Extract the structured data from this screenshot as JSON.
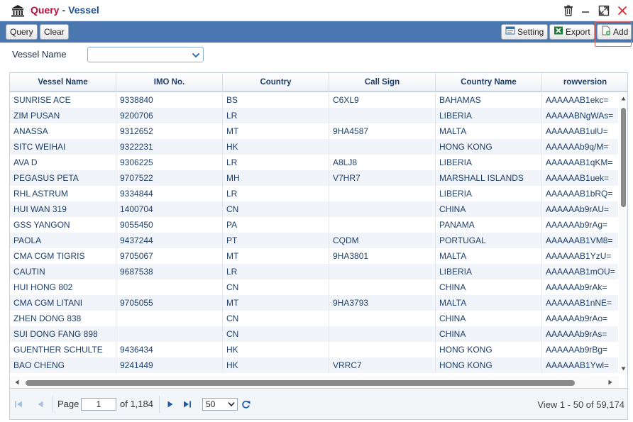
{
  "window": {
    "title_query": "Query",
    "title_separator": "-",
    "title_vessel": "Vessel",
    "icons": [
      "bank-icon",
      "trash-icon",
      "minimize-icon",
      "maximize-icon",
      "close-icon"
    ]
  },
  "toolbar": {
    "query_label": "Query",
    "clear_label": "Clear",
    "setting_label": "Setting",
    "export_label": "Export",
    "add_label": "Add"
  },
  "filter": {
    "vessel_name_label": "Vessel Name",
    "vessel_name_value": ""
  },
  "grid": {
    "columns": [
      "Vessel Name",
      "IMO No.",
      "Country",
      "Call Sign",
      "Country Name",
      "rowversion"
    ],
    "rows": [
      [
        "SUNRISE ACE",
        "9338840",
        "BS",
        "C6XL9",
        "BAHAMAS",
        "AAAAAAB1ekc="
      ],
      [
        "ZIM PUSAN",
        "9200706",
        "LR",
        "",
        "LIBERIA",
        "AAAAABNgWAs="
      ],
      [
        "ANASSA",
        "9312652",
        "MT",
        "9HA4587",
        "MALTA",
        "AAAAAAB1ulU="
      ],
      [
        "SITC WEIHAI",
        "9322231",
        "HK",
        "",
        "HONG KONG",
        "AAAAAAb9q/M="
      ],
      [
        "AVA D",
        "9306225",
        "LR",
        "A8LJ8",
        "LIBERIA",
        "AAAAAAB1qKM="
      ],
      [
        "PEGASUS PETA",
        "9707522",
        "MH",
        "V7HR7",
        "MARSHALL ISLANDS",
        "AAAAAAB1uek="
      ],
      [
        "RHL ASTRUM",
        "9334844",
        "LR",
        "",
        "LIBERIA",
        "AAAAAAB1bRQ="
      ],
      [
        "HUI WAN 319",
        "1400704",
        "CN",
        "",
        "CHINA",
        "AAAAAAb9rAU="
      ],
      [
        "GSS YANGON",
        "9055450",
        "PA",
        "",
        "PANAMA",
        "AAAAAAb9rAg="
      ],
      [
        "PAOLA",
        "9437244",
        "PT",
        "CQDM",
        "PORTUGAL",
        "AAAAAAB1VM8="
      ],
      [
        "CMA CGM TIGRIS",
        "9705067",
        "MT",
        "9HA3801",
        "MALTA",
        "AAAAAAB1YzU="
      ],
      [
        "CAUTIN",
        "9687538",
        "LR",
        "",
        "LIBERIA",
        "AAAAAAB1mOU="
      ],
      [
        "HUI HONG 802",
        "",
        "CN",
        "",
        "CHINA",
        "AAAAAAb9rAk="
      ],
      [
        "CMA CGM LITANI",
        "9705055",
        "MT",
        "9HA3793",
        "MALTA",
        "AAAAAAB1nNE="
      ],
      [
        "ZHEN DONG 838",
        "",
        "CN",
        "",
        "CHINA",
        "AAAAAAb9rAo="
      ],
      [
        "SUI DONG FANG 898",
        "",
        "CN",
        "",
        "CHINA",
        "AAAAAAb9rAs="
      ],
      [
        "GUENTHER SCHULTE",
        "9436434",
        "HK",
        "",
        "HONG KONG",
        "AAAAAAb9rBg="
      ],
      [
        "BAO CHENG",
        "9241449",
        "HK",
        "VRRC7",
        "HONG KONG",
        "AAAAAAB1Ywl="
      ]
    ]
  },
  "pager": {
    "page_label": "Page",
    "page_value": "1",
    "of_label": "of 1,184",
    "page_size": "50",
    "view_text": "View 1 - 50 of 59,174"
  }
}
